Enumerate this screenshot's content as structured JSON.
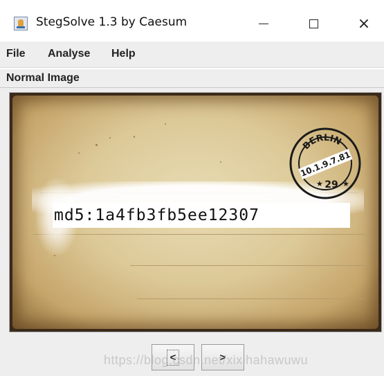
{
  "window": {
    "title": "StegSolve 1.3 by Caesum",
    "icon": "java-app-icon",
    "controls": {
      "minimize": "minimize-icon",
      "maximize": "maximize-icon",
      "close": "×"
    }
  },
  "menu": {
    "items": [
      {
        "label": "File"
      },
      {
        "label": "Analyse"
      },
      {
        "label": "Help"
      }
    ]
  },
  "mode_label": "Normal Image",
  "image": {
    "hidden_text": "md5:1a4fb3fb5ee12307",
    "postmark": {
      "city": "BERLIN",
      "date": "10.1.9.7.81",
      "code": "29"
    }
  },
  "navigation": {
    "prev_label": "<",
    "next_label": ">"
  },
  "watermark": "https://blog.csdn.net/xixihahawuwu",
  "colors": {
    "window_bg": "#eeeeee",
    "postcard": "#dcc998",
    "hidden_text_bg": "#ffffff"
  }
}
